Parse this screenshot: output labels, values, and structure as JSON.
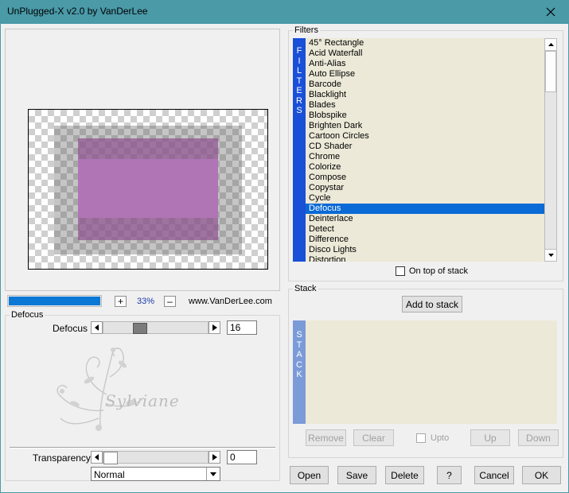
{
  "window": {
    "title": "UnPlugged-X v2.0 by VanDerLee"
  },
  "preview": {
    "zoom_label": "33%",
    "website": "www.VanDerLee.com",
    "progress": 1.0
  },
  "filters": {
    "group_label": "Filters",
    "side_label": "FILTERS",
    "items": [
      "45° Rectangle",
      "Acid Waterfall",
      "Anti-Alias",
      "Auto Ellipse",
      "Barcode",
      "Blacklight",
      "Blades",
      "Blobspike",
      "Brighten Dark",
      "Cartoon Circles",
      "CD Shader",
      "Chrome",
      "Colorize",
      "Compose",
      "Copystar",
      "Cycle",
      "Defocus",
      "Deinterlace",
      "Detect",
      "Difference",
      "Disco Lights",
      "Distortion"
    ],
    "selected": "Defocus",
    "on_top_label": "On top of stack",
    "on_top_checked": false
  },
  "stack": {
    "group_label": "Stack",
    "side_label": "STACK",
    "add_label": "Add to stack",
    "remove_label": "Remove",
    "clear_label": "Clear",
    "upto_label": "Upto",
    "up_label": "Up",
    "down_label": "Down"
  },
  "params": {
    "group_label": "Defocus",
    "defocus_label": "Defocus",
    "defocus_value": "16",
    "defocus_level": 0.32,
    "transparency_label": "Transparency",
    "transparency_value": "0",
    "transparency_level": 0,
    "blend_mode": "Normal"
  },
  "watermark": {
    "text": "Sylviane"
  },
  "buttons": {
    "open": "Open",
    "save": "Save",
    "delete": "Delete",
    "help": "?",
    "cancel": "Cancel",
    "ok": "OK"
  },
  "colors": {
    "titlebar": "#4a9aa8",
    "selection": "#0a6ad6",
    "list_bg": "#ece9d8",
    "filters_side": "#1a4fd8",
    "stack_side": "#7b9ad8",
    "preview_fill": "#b075b5"
  }
}
